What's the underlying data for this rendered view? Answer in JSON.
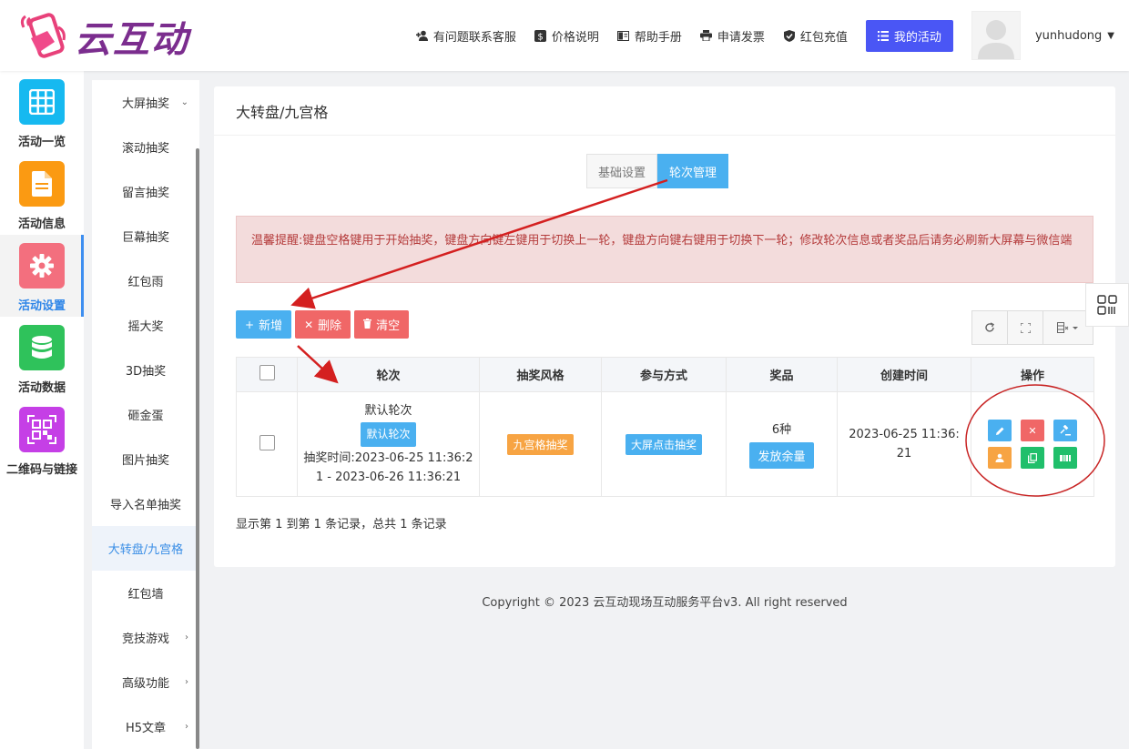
{
  "header": {
    "logo_text": "云互动",
    "nav": [
      {
        "label": "有问题联系客服",
        "icon": "user-plus-icon"
      },
      {
        "label": "价格说明",
        "icon": "dollar-icon"
      },
      {
        "label": "帮助手册",
        "icon": "book-icon"
      },
      {
        "label": "申请发票",
        "icon": "printer-icon"
      },
      {
        "label": "红包充值",
        "icon": "shield-check-icon"
      }
    ],
    "my_activity": "我的活动",
    "username": "yunhudong"
  },
  "iconbar": [
    {
      "label": "活动一览",
      "color": "#16b9f0",
      "icon": "grid-icon"
    },
    {
      "label": "活动信息",
      "color": "#fb9a12",
      "icon": "document-icon"
    },
    {
      "label": "活动设置",
      "color": "#f36f7e",
      "icon": "gear-icon"
    },
    {
      "label": "活动数据",
      "color": "#2fc25b",
      "icon": "database-icon"
    },
    {
      "label": "二维码与链接",
      "color": "#c53fe6",
      "icon": "qrcode-icon"
    }
  ],
  "submenu": [
    {
      "label": "大屏抽奖",
      "arrow": "⌄"
    },
    {
      "label": "滚动抽奖"
    },
    {
      "label": "留言抽奖"
    },
    {
      "label": "巨幕抽奖"
    },
    {
      "label": "红包雨"
    },
    {
      "label": "摇大奖"
    },
    {
      "label": "3D抽奖"
    },
    {
      "label": "砸金蛋"
    },
    {
      "label": "图片抽奖"
    },
    {
      "label": "导入名单抽奖"
    },
    {
      "label": "大转盘/九宫格"
    },
    {
      "label": "红包墙"
    },
    {
      "label": "竞技游戏",
      "arrow": "›"
    },
    {
      "label": "高级功能",
      "arrow": "›"
    },
    {
      "label": "H5文章",
      "arrow": "›"
    }
  ],
  "card": {
    "title": "大转盘/九宫格",
    "tabs": [
      "基础设置",
      "轮次管理"
    ],
    "alert": "温馨提醒:键盘空格键用于开始抽奖，键盘方向键左键用于切换上一轮，键盘方向键右键用于切换下一轮；修改轮次信息或者奖品后请务必刷新大屏幕与微信端",
    "toolbar": {
      "add": "新增",
      "delete": "删除",
      "clear": "清空"
    },
    "table": {
      "headers": [
        "轮次",
        "抽奖风格",
        "参与方式",
        "奖品",
        "创建时间",
        "操作"
      ],
      "rows": [
        {
          "round_name": "默认轮次",
          "round_badge": "默认轮次",
          "round_time": "抽奖时间:2023-06-25 11:36:21 - 2023-06-26 11:36:21",
          "style": "九宫格抽奖",
          "mode": "大屏点击抽奖",
          "prize_count": "6种",
          "prize_button": "发放余量",
          "created": "2023-06-25 11:36:21"
        }
      ]
    },
    "summary": "显示第 1 到第 1 条记录，总共 1 条记录"
  },
  "copyright": "Copyright © 2023 云互动现场互动服务平台v3. All right reserved",
  "colors": {
    "primary": "#4a56f5",
    "info": "#4ab0f0",
    "danger": "#f06767",
    "warning": "#f7a443",
    "success": "#20bf6b",
    "annotation": "#d42020"
  }
}
